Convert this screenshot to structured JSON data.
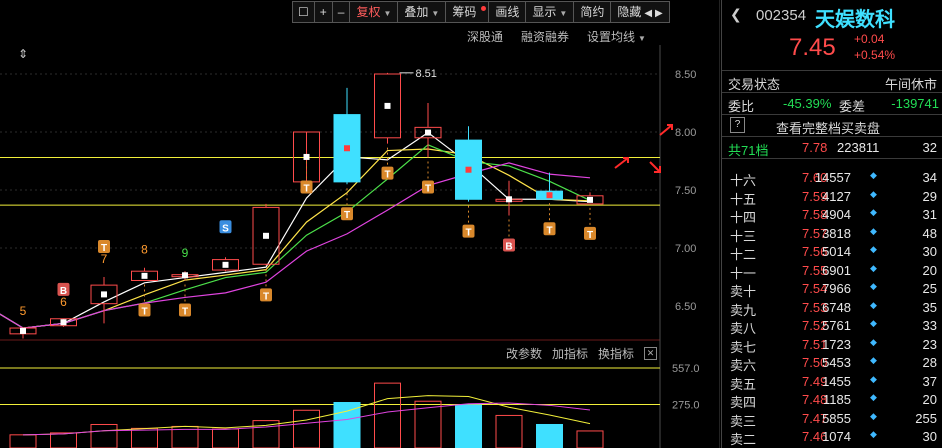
{
  "toolbar": {
    "buttons": [
      "复权",
      "叠加",
      "筹码",
      "画线",
      "显示",
      "简约",
      "隐藏"
    ],
    "arrows": [
      "◀",
      "▶"
    ]
  },
  "chart_links": [
    "深股通",
    "融资融券",
    "设置均线"
  ],
  "indicator_links": [
    "改参数",
    "加指标",
    "换指标"
  ],
  "price_axis": [
    "8.51",
    "8.50",
    "8.00",
    "7.50",
    "7.00",
    "6.50"
  ],
  "volume_axis": [
    "557.0",
    "275.0"
  ],
  "stock": {
    "code": "002354",
    "name": "天娱数科",
    "price": "7.45",
    "change": "+0.04",
    "change_pct": "+0.54%"
  },
  "status": {
    "label": "交易状态",
    "value": "午间休市"
  },
  "ratio": {
    "label1": "委比",
    "value1": "-45.39%",
    "label2": "委差",
    "value2": "-139741"
  },
  "order_book_button": {
    "label": "查看完整档买卖盘"
  },
  "levels_header": {
    "label": "共71档",
    "price": "7.78",
    "volume": "223811",
    "count": "32"
  },
  "order_levels": [
    {
      "label": "十六",
      "price": "7.60",
      "volume": "14557",
      "count": "34"
    },
    {
      "label": "十五",
      "price": "7.59",
      "volume": "4127",
      "count": "29"
    },
    {
      "label": "十四",
      "price": "7.58",
      "volume": "4904",
      "count": "31"
    },
    {
      "label": "十三",
      "price": "7.57",
      "volume": "3818",
      "count": "48"
    },
    {
      "label": "十二",
      "price": "7.56",
      "volume": "5014",
      "count": "30"
    },
    {
      "label": "十一",
      "price": "7.55",
      "volume": "6901",
      "count": "20"
    },
    {
      "label": "卖十",
      "price": "7.54",
      "volume": "7966",
      "count": "25"
    },
    {
      "label": "卖九",
      "price": "7.53",
      "volume": "6748",
      "count": "35"
    },
    {
      "label": "卖八",
      "price": "7.52",
      "volume": "5761",
      "count": "33"
    },
    {
      "label": "卖七",
      "price": "7.51",
      "volume": "1723",
      "count": "23"
    },
    {
      "label": "卖六",
      "price": "7.50",
      "volume": "5453",
      "count": "28"
    },
    {
      "label": "卖五",
      "price": "7.49",
      "volume": "1455",
      "count": "37"
    },
    {
      "label": "卖四",
      "price": "7.48",
      "volume": "1185",
      "count": "20"
    },
    {
      "label": "卖三",
      "price": "7.47",
      "volume": "5855",
      "count": "255"
    },
    {
      "label": "卖二",
      "price": "7.46",
      "volume": "1074",
      "count": "30"
    }
  ],
  "chart_data": {
    "type": "candlestick",
    "price_range": [
      6.25,
      8.75
    ],
    "high_label": "8.51",
    "candles": [
      {
        "o": 6.26,
        "h": 6.3,
        "l": 6.22,
        "c": 6.31,
        "up": true
      },
      {
        "o": 6.33,
        "h": 6.38,
        "l": 6.32,
        "c": 6.39,
        "up": true
      },
      {
        "o": 6.52,
        "h": 6.75,
        "l": 6.35,
        "c": 6.68,
        "up": true
      },
      {
        "o": 6.8,
        "h": 6.83,
        "l": 6.72,
        "c": 6.72,
        "up": true
      },
      {
        "o": 6.76,
        "h": 6.8,
        "l": 6.72,
        "c": 6.77,
        "up": true
      },
      {
        "o": 6.9,
        "h": 6.92,
        "l": 6.8,
        "c": 6.81,
        "up": true
      },
      {
        "o": 7.35,
        "h": 7.38,
        "l": 6.85,
        "c": 6.86,
        "up": true
      },
      {
        "o": 7.57,
        "h": 7.6,
        "l": 7.78,
        "c": 8.0,
        "up": true
      },
      {
        "o": 8.15,
        "h": 8.38,
        "l": 7.55,
        "c": 7.57,
        "up": false
      },
      {
        "o": 8.5,
        "h": 8.51,
        "l": 7.9,
        "c": 7.95,
        "up": true
      },
      {
        "o": 7.95,
        "h": 8.25,
        "l": 7.78,
        "c": 8.04,
        "up": true
      },
      {
        "o": 7.93,
        "h": 8.05,
        "l": 7.4,
        "c": 7.42,
        "up": false
      },
      {
        "o": 7.42,
        "h": 7.58,
        "l": 7.28,
        "c": 7.42,
        "up": true
      },
      {
        "o": 7.49,
        "h": 7.65,
        "l": 7.42,
        "c": 7.42,
        "up": false
      },
      {
        "o": 7.45,
        "h": 7.48,
        "l": 7.38,
        "c": 7.38,
        "up": true
      }
    ],
    "markers": [
      {
        "i": 0,
        "text": "5",
        "kind": "num",
        "color": "#ff9a2e"
      },
      {
        "i": 1,
        "text": "6",
        "kind": "num",
        "color": "#ff9a2e"
      },
      {
        "i": 1,
        "text": "B",
        "kind": "box",
        "color": "#d9534f"
      },
      {
        "i": 2,
        "text": "7",
        "kind": "num",
        "color": "#ff9a2e"
      },
      {
        "i": 2,
        "text": "T",
        "kind": "box",
        "color": "#d9882b"
      },
      {
        "i": 3,
        "text": "8",
        "kind": "num",
        "color": "#ff9a2e"
      },
      {
        "i": 3,
        "text": "T",
        "kind": "box",
        "color": "#d9882b",
        "below": true
      },
      {
        "i": 4,
        "text": "9",
        "kind": "num",
        "color": "#48e04a"
      },
      {
        "i": 4,
        "text": "T",
        "kind": "box",
        "color": "#d9882b",
        "below": true
      },
      {
        "i": 5,
        "text": "S",
        "kind": "box",
        "color": "#3a8ee0"
      },
      {
        "i": 6,
        "text": "T",
        "kind": "box",
        "color": "#d9882b",
        "below": true
      },
      {
        "i": 7,
        "text": "T",
        "kind": "box",
        "color": "#d9882b",
        "below": true
      },
      {
        "i": 8,
        "text": "T",
        "kind": "box",
        "color": "#d9882b",
        "below": true
      },
      {
        "i": 9,
        "text": "T",
        "kind": "box",
        "color": "#d9882b",
        "below": true
      },
      {
        "i": 10,
        "text": "T",
        "kind": "box",
        "color": "#d9882b",
        "below": true
      },
      {
        "i": 11,
        "text": "T",
        "kind": "box",
        "color": "#d9882b",
        "below": true
      },
      {
        "i": 12,
        "text": "B",
        "kind": "box",
        "color": "#d9534f",
        "below": true
      },
      {
        "i": 13,
        "text": "T",
        "kind": "box",
        "color": "#d9882b",
        "below": true
      },
      {
        "i": 14,
        "text": "T",
        "kind": "box",
        "color": "#d9882b",
        "below": true
      }
    ],
    "volume": [
      40,
      55,
      120,
      90,
      105,
      85,
      150,
      230,
      290,
      440,
      300,
      270,
      190,
      120,
      70
    ],
    "volume_range": [
      0,
      557
    ],
    "hlines": [
      7.78,
      7.37
    ],
    "vol_hlines": [
      557,
      275
    ]
  }
}
